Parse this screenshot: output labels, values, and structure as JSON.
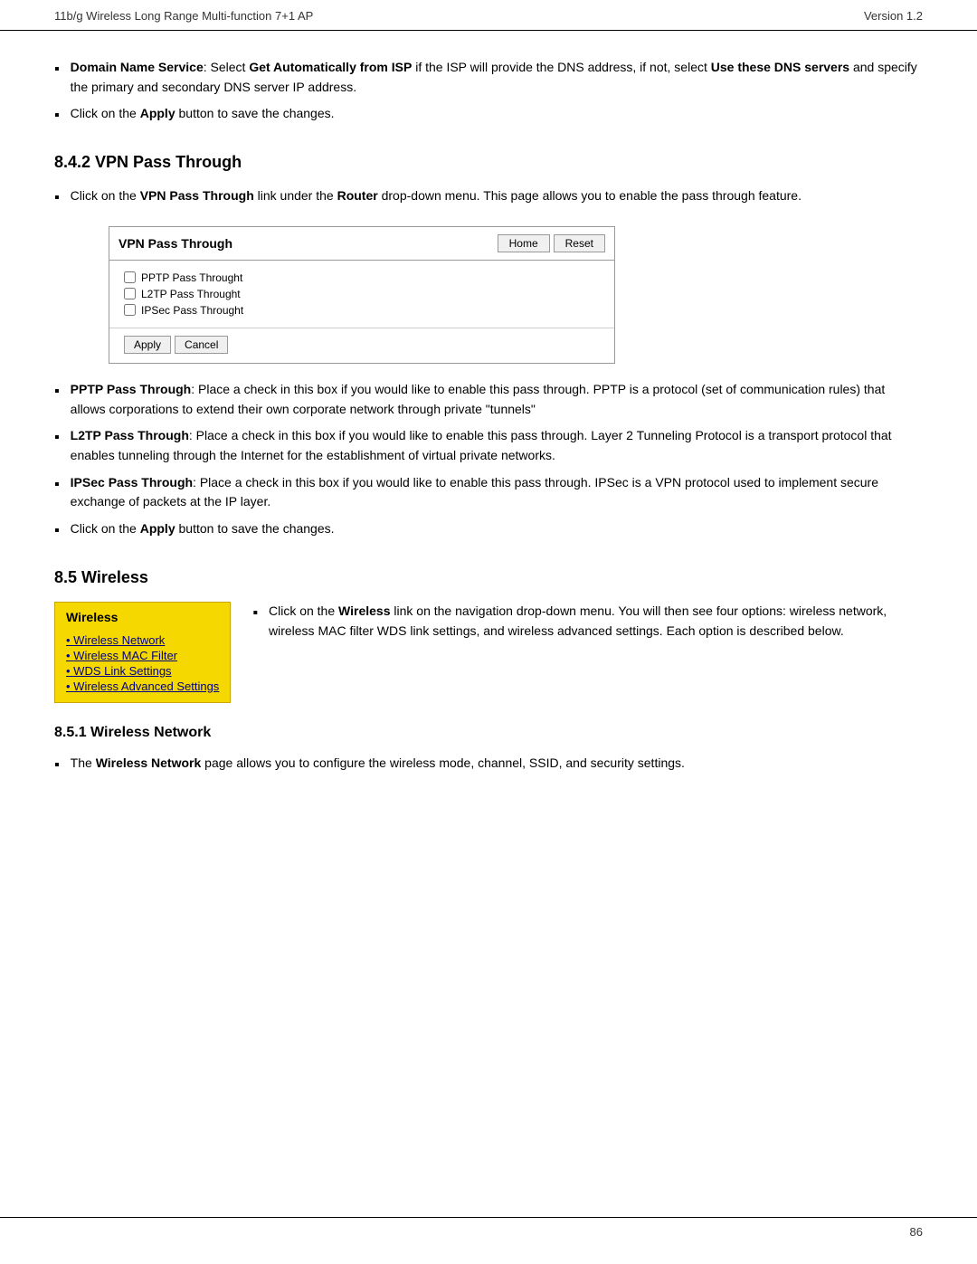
{
  "header": {
    "left": "11b/g Wireless Long Range Multi-function 7+1 AP",
    "right": "Version 1.2"
  },
  "dns_bullets": [
    {
      "bold_prefix": "Domain Name Service",
      "text": ": Select ",
      "bold_middle": "Get Automatically from ISP",
      "text2": " if the ISP will provide the DNS address, if not, select ",
      "bold_end": "Use these DNS servers",
      "text3": " and specify the primary and secondary DNS server IP address."
    },
    {
      "text_pre": "Click on the ",
      "bold": "Apply",
      "text_post": " button to save the changes."
    }
  ],
  "section_842": {
    "heading": "8.4.2  VPN Pass Through",
    "bullet": {
      "text_pre": "Click on the ",
      "bold": "VPN Pass Through",
      "text_mid": " link under the ",
      "bold2": "Router",
      "text_post": " drop-down menu. This page allows you to enable the pass through feature."
    }
  },
  "vpn_box": {
    "title": "VPN Pass Through",
    "btn_home": "Home",
    "btn_reset": "Reset",
    "checkboxes": [
      "PPTP Pass Throught",
      "L2TP Pass Throught",
      "IPSec Pass Throught"
    ],
    "btn_apply": "Apply",
    "btn_cancel": "Cancel"
  },
  "vpn_bullets": [
    {
      "bold": "PPTP Pass Through",
      "text": ": Place a check in this box if you would like to enable this pass through. PPTP is a protocol (set of communication rules) that allows corporations to extend their own corporate network through private \"tunnels\""
    },
    {
      "bold": "L2TP Pass Through",
      "text": ": Place a check in this box if you would like to enable this pass through. Layer 2 Tunneling Protocol is a transport protocol that enables tunneling through the Internet for the establishment of virtual private networks."
    },
    {
      "bold": "IPSec Pass Through",
      "text": ": Place a check in this box if you would like to enable this pass through. IPSec is a VPN protocol used to implement secure exchange of packets at the IP layer."
    },
    {
      "text_pre": "Click on the ",
      "bold": "Apply",
      "text_post": " button to save the changes."
    }
  ],
  "section_85": {
    "heading": "8.5  Wireless",
    "menu_title": "Wireless",
    "menu_items": [
      "Wireless Network",
      "Wireless MAC Filter",
      "WDS Link Settings",
      "Wireless Advanced Settings"
    ],
    "desc_pre": "Click on the ",
    "desc_bold": "Wireless",
    "desc_text": " link on the navigation drop-down menu. You will then see four options: wireless network, wireless MAC filter WDS link settings, and wireless advanced settings. Each option is described below."
  },
  "section_851": {
    "heading": "8.5.1  Wireless Network",
    "bullet": {
      "text_pre": "The ",
      "bold": "Wireless Network",
      "text_post": " page allows you to configure the wireless mode, channel, SSID, and security settings."
    }
  },
  "footer": {
    "page_number": "86"
  }
}
